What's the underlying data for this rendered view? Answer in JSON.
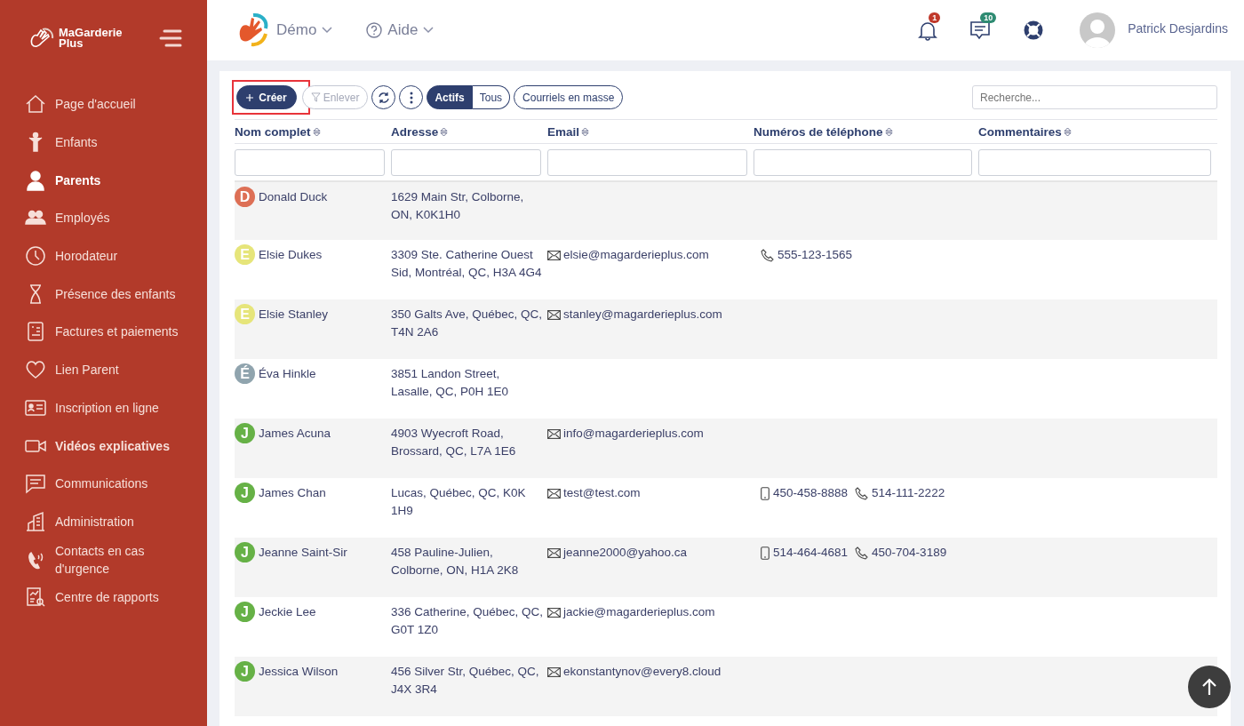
{
  "brand": {
    "line_1": "MaGarderie",
    "line_2": "Plus"
  },
  "sidebar": {
    "items": [
      {
        "label": "Page d'accueil",
        "selected": false,
        "bold": false
      },
      {
        "label": "Enfants",
        "selected": false,
        "bold": false
      },
      {
        "label": "Parents",
        "selected": true,
        "bold": false
      },
      {
        "label": "Employés",
        "selected": false,
        "bold": false
      },
      {
        "label": "Horodateur",
        "selected": false,
        "bold": false
      },
      {
        "label": "Présence des enfants",
        "selected": false,
        "bold": false
      },
      {
        "label": "Factures et paiements",
        "selected": false,
        "bold": false
      },
      {
        "label": "Lien Parent",
        "selected": false,
        "bold": false
      },
      {
        "label": "Inscription en ligne",
        "selected": false,
        "bold": false
      },
      {
        "label": "Vidéos explicatives",
        "selected": false,
        "bold": true
      },
      {
        "label": "Communications",
        "selected": false,
        "bold": false
      },
      {
        "label": "Administration",
        "selected": false,
        "bold": false
      },
      {
        "label": "Contacts en cas d'urgence",
        "selected": false,
        "bold": false
      },
      {
        "label": "Centre de rapports",
        "selected": false,
        "bold": false
      }
    ]
  },
  "topbar": {
    "menus": [
      "Démo",
      "Aide"
    ],
    "notifications_badge": "1",
    "messages_badge": "10",
    "user_name": "Patrick Desjardins"
  },
  "toolbar": {
    "create": "Créer",
    "create_highlighted": true,
    "remove": "Enlever",
    "remove_disabled": true,
    "segments": [
      {
        "label": "Actifs",
        "selected": true
      },
      {
        "label": "Tous",
        "selected": false
      }
    ],
    "mass_email": "Courriels en masse",
    "search_placeholder": "Recherche..."
  },
  "table": {
    "columns": [
      "Nom complet",
      "Adresse",
      "Email",
      "Numéros de téléphone",
      "Commentaires"
    ],
    "rows": [
      {
        "initial": "D",
        "color": "#dd6f55",
        "name": "Donald Duck",
        "address": "1629 Main Str, Colborne, ON, K0K1H0",
        "phones": []
      },
      {
        "initial": "E",
        "color": "#e6e57a",
        "name": "Elsie Dukes",
        "address": "3309 Ste. Catherine Ouest Sid, Montréal, QC, H3A 4G4",
        "email": "elsie@magarderieplus.com",
        "phones": [
          {
            "kind": "landline",
            "number": "555-123-1565"
          }
        ]
      },
      {
        "initial": "E",
        "color": "#e6e57a",
        "name": "Elsie Stanley",
        "address": "350 Galts Ave, Québec, QC, T4N 2A6",
        "email": "stanley@magarderieplus.com",
        "phones": []
      },
      {
        "initial": "É",
        "color": "#90a4ae",
        "name": "Éva Hinkle",
        "address": "3851 Landon Street, Lasalle, QC, P0H 1E0",
        "phones": []
      },
      {
        "initial": "J",
        "color": "#66b146",
        "name": "James Acuna",
        "address": "4903 Wyecroft Road, Brossard, QC, L7A 1E6",
        "email": "info@magarderieplus.com",
        "phones": []
      },
      {
        "initial": "J",
        "color": "#66b146",
        "name": "James Chan",
        "address": "Lucas, Québec, QC, K0K 1H9",
        "email": "test@test.com",
        "phones": [
          {
            "kind": "mobile",
            "number": "450-458-8888"
          },
          {
            "kind": "landline",
            "number": "514-111-2222"
          }
        ]
      },
      {
        "initial": "J",
        "color": "#66b146",
        "name": "Jeanne Saint-Sir",
        "address": "458 Pauline-Julien, Colborne, ON, H1A 2K8",
        "email": "jeanne2000@yahoo.ca",
        "phones": [
          {
            "kind": "mobile",
            "number": "514-464-4681"
          },
          {
            "kind": "landline",
            "number": "450-704-3189"
          }
        ]
      },
      {
        "initial": "J",
        "color": "#66b146",
        "name": "Jeckie Lee",
        "address": "336 Catherine, Québec, QC, G0T 1Z0",
        "email": "jackie@magarderieplus.com",
        "phones": []
      },
      {
        "initial": "J",
        "color": "#66b146",
        "name": "Jessica Wilson",
        "address": "456 Silver Str, Québec, QC, J4X 3R4",
        "email": "ekonstantynov@every8.cloud",
        "phones": []
      }
    ]
  }
}
